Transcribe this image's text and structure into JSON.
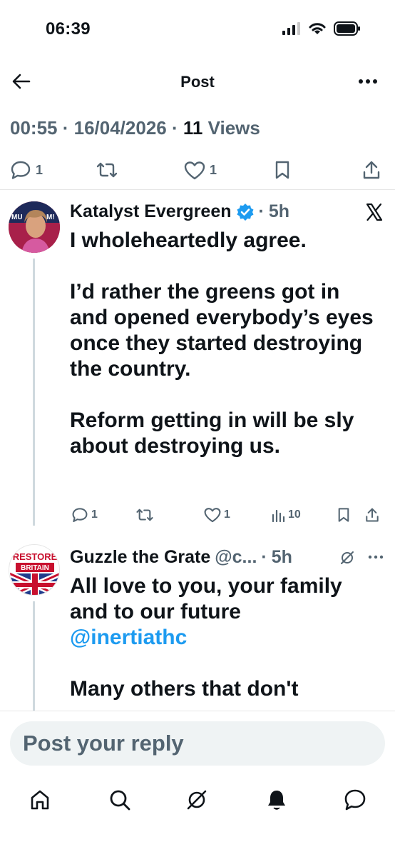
{
  "status_bar": {
    "time": "06:39"
  },
  "topbar": {
    "title": "Post"
  },
  "post_meta": {
    "time": "00:55",
    "date": "16/04/2026",
    "views_count": "11",
    "views_label": "Views"
  },
  "post_actions": {
    "replies": "1",
    "likes": "1"
  },
  "replies": [
    {
      "name": "Katalyst Evergreen",
      "verified": true,
      "age": "5h",
      "avatar_text": [
        "MU",
        "M!"
      ],
      "paragraphs": [
        "I wholeheartedly agree.",
        "I’d rather the greens got in and opened everybody’s eyes once they started destroying the country.",
        "Reform getting in will be sly about destroying us."
      ],
      "replies": "1",
      "likes": "1",
      "views": "10"
    },
    {
      "name": "Guzzle the Grate",
      "handle": "@c...",
      "age": "5h",
      "avatar_text": [
        "RESTORE",
        "BRITAIN"
      ],
      "paragraph1": "All love to you, your family and to our future",
      "mention": "@inertiathc",
      "paragraph2": "Many others that don't"
    }
  ],
  "composer": {
    "placeholder": "Post your reply"
  },
  "colors": {
    "accent": "#1d9bf0",
    "muted": "#536471",
    "text": "#0f1419",
    "input_bg": "#eff3f4"
  }
}
